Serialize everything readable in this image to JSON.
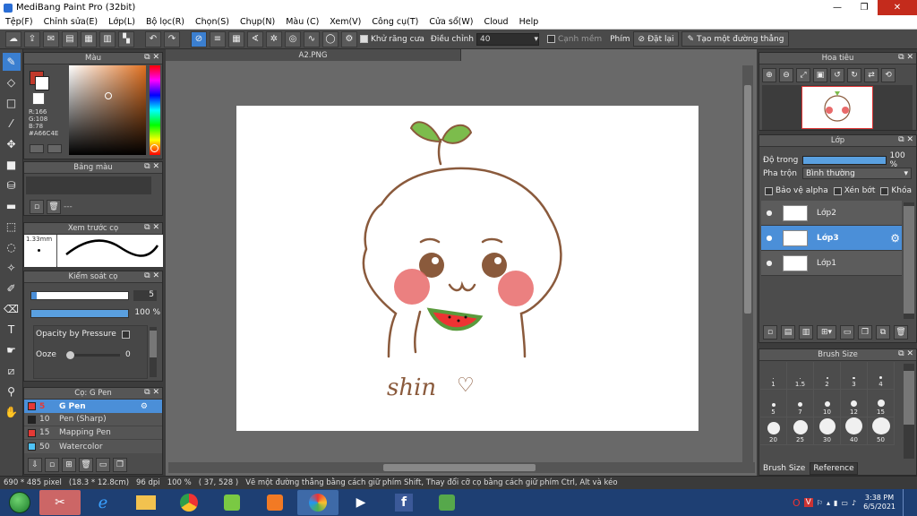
{
  "window": {
    "title": "MediBang Paint Pro (32bit)",
    "buttons": {
      "min": "—",
      "max": "❐",
      "close": "✕"
    }
  },
  "menu": [
    "Tệp(F)",
    "Chỉnh sửa(E)",
    "Lớp(L)",
    "Bộ lọc(R)",
    "Chọn(S)",
    "Chụp(N)",
    "Màu (C)",
    "Xem(V)",
    "Công cụ(T)",
    "Cửa sổ(W)",
    "Cloud",
    "Help"
  ],
  "toolbar": {
    "antialias_label": "Khử răng cưa",
    "correction_label": "Điều chỉnh",
    "correction_value": "40",
    "edge_label": "Cạnh mềm",
    "key_label": "Phím",
    "reset_label": "Đặt lại",
    "line_label": "Tạo một đường thẳng"
  },
  "color_panel": {
    "title": "Màu",
    "r": "R:166",
    "g": "G:108",
    "b": "B:78",
    "hex": "#A66C4E",
    "primary": "#c0392b",
    "secondary": "#ffffff"
  },
  "palette_panel": {
    "title": "Bảng màu",
    "text": "---"
  },
  "brush_preview": {
    "title": "Xem trước cọ",
    "size": "1.33mm"
  },
  "brush_control": {
    "title": "Kiểm soát cọ",
    "size_value": "5",
    "opacity_value": "100 %",
    "opacity_pressure": "Opacity by Pressure",
    "ooze_label": "Ooze",
    "ooze_value": "0"
  },
  "brush_list": {
    "title": "Cọ: G Pen",
    "items": [
      {
        "size": "5",
        "name": "G Pen",
        "color": "#e53935"
      },
      {
        "size": "10",
        "name": "Pen (Sharp)",
        "color": "#222222"
      },
      {
        "size": "15",
        "name": "Mapping Pen",
        "color": "#e53935"
      },
      {
        "size": "50",
        "name": "Watercolor",
        "color": "#4fc3f7"
      }
    ]
  },
  "document": {
    "tab": "A2.PNG",
    "caption": "shin"
  },
  "navigator": {
    "title": "Hoa tiêu"
  },
  "layers": {
    "title": "Lớp",
    "opacity_label": "Độ trong",
    "opacity_value": "100 %",
    "opacity_fraction": 1.0,
    "blend_label": "Pha trộn",
    "blend_value": "Bình thường",
    "protect_alpha": "Bảo vệ alpha",
    "clipping": "Xén bớt",
    "lock": "Khóa",
    "items": [
      {
        "name": "Lớp2",
        "selected": false
      },
      {
        "name": "Lớp3",
        "selected": true
      },
      {
        "name": "Lớp1",
        "selected": false
      }
    ]
  },
  "brush_size": {
    "title": "Brush Size",
    "sizes": [
      "1",
      "1.5",
      "2",
      "3",
      "4",
      "5",
      "7",
      "10",
      "12",
      "15",
      "20",
      "25",
      "30",
      "40",
      "50"
    ],
    "tabs": [
      "Brush Size",
      "Reference"
    ]
  },
  "status": {
    "dims": "690 * 485 pixel",
    "mm": "(18.3 * 12.8cm)",
    "dpi": "96 dpi",
    "zoom": "100 %",
    "coords": "( 37, 528 )",
    "hint": "Vẽ một đường thẳng bằng cách giữ phím Shift, Thay đổi cỡ cọ bằng cách giữ phím Ctrl, Alt và kéo"
  },
  "clock": {
    "time": "3:38 PM",
    "date": "6/5/2021"
  }
}
